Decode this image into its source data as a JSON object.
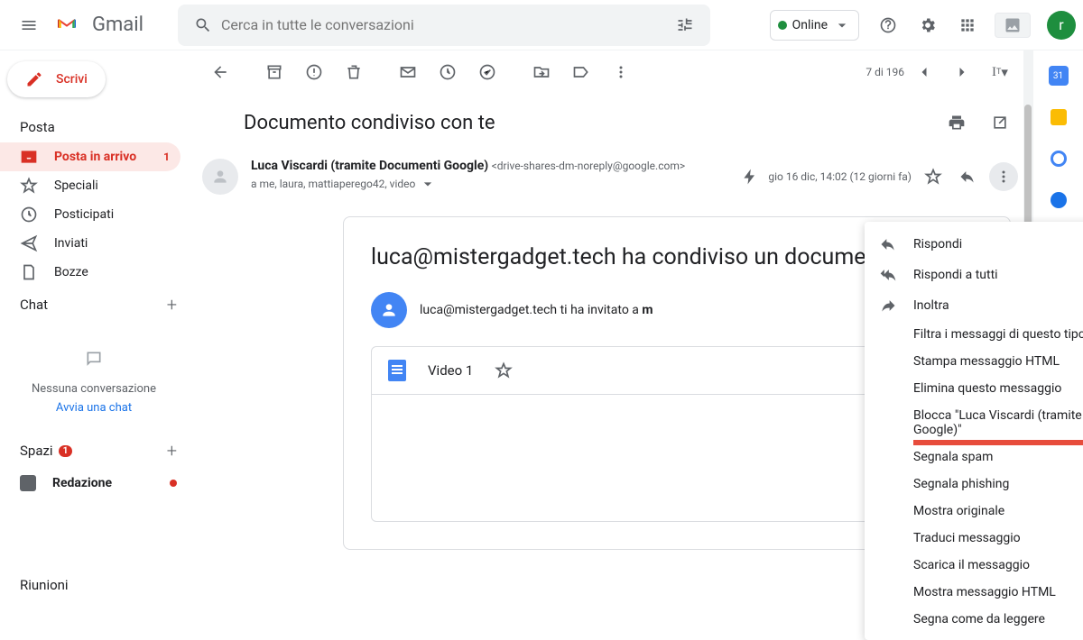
{
  "header": {
    "app_name": "Gmail",
    "search_placeholder": "Cerca in tutte le conversazioni",
    "online_label": "Online",
    "avatar_initial": "r"
  },
  "compose_label": "Scrivi",
  "sections": {
    "posta": "Posta",
    "chat": "Chat",
    "spazi": "Spazi",
    "riunioni": "Riunioni"
  },
  "nav": [
    {
      "label": "Posta in arrivo",
      "count": "1",
      "active": true,
      "icon": "inbox"
    },
    {
      "label": "Speciali",
      "icon": "star"
    },
    {
      "label": "Posticipati",
      "icon": "clock"
    },
    {
      "label": "Inviati",
      "icon": "send"
    },
    {
      "label": "Bozze",
      "icon": "draft"
    }
  ],
  "chat_empty": {
    "text": "Nessuna conversazione",
    "link": "Avvia una chat"
  },
  "spazi_badge": "1",
  "space_item": {
    "label": "Redazione"
  },
  "toolbar": {
    "counter": "7 di 196"
  },
  "email": {
    "subject": "Documento condiviso con te",
    "sender_name": "Luca Viscardi (tramite Documenti Google)",
    "sender_email": "<drive-shares-dm-noreply@google.com>",
    "recipients": "a me, laura, mattiaperego42, video",
    "date": "gio 16 dic, 14:02 (12 giorni fa)",
    "body_title": "luca@mistergadget.tech ha condiviso un documento",
    "body_text_prefix": "luca@mistergadget.tech ti ha invitato a ",
    "body_text_bold": "m",
    "doc_name": "Video 1"
  },
  "menu": [
    {
      "label": "Rispondi",
      "icon": "reply"
    },
    {
      "label": "Rispondi a tutti",
      "icon": "reply-all"
    },
    {
      "label": "Inoltra",
      "icon": "forward"
    },
    {
      "label": "Filtra i messaggi di questo tipo"
    },
    {
      "label": "Stampa messaggio HTML"
    },
    {
      "label": "Elimina questo messaggio"
    },
    {
      "label": "Blocca \"Luca Viscardi (tramite Documenti Google)\"",
      "highlight": true
    },
    {
      "label": "Segnala spam"
    },
    {
      "label": "Segnala phishing"
    },
    {
      "label": "Mostra originale"
    },
    {
      "label": "Traduci messaggio"
    },
    {
      "label": "Scarica il messaggio"
    },
    {
      "label": "Mostra messaggio HTML"
    },
    {
      "label": "Segna come da leggere"
    }
  ],
  "rightbar": {
    "calendar_day": "31"
  }
}
